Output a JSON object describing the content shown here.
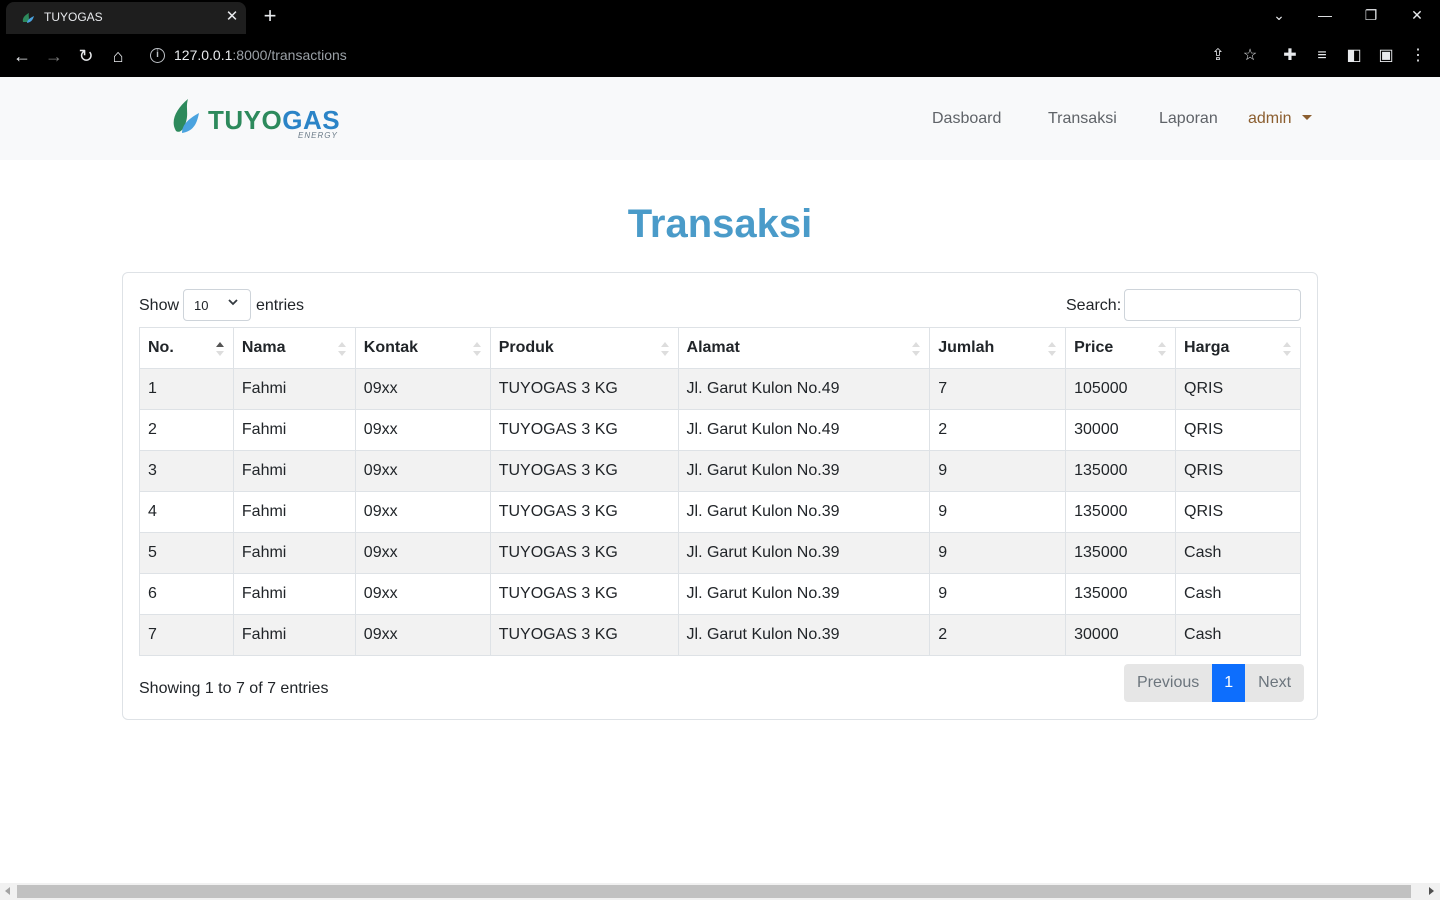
{
  "browser": {
    "tab_title": "TUYOGAS",
    "url_host": "127.0.0.1",
    "url_path": ":8000/transactions"
  },
  "navbar": {
    "brand_name_1": "TUYO",
    "brand_name_2": "GAS",
    "brand_sub": "ENERGY",
    "links": [
      "Dasboard",
      "Transaksi",
      "Laporan"
    ],
    "user": "admin"
  },
  "page": {
    "title": "Transaksi"
  },
  "table_controls": {
    "show_label": "Show",
    "entries_value": "10",
    "entries_label": "entries",
    "search_label": "Search:",
    "search_value": ""
  },
  "table": {
    "columns": [
      "No.",
      "Nama",
      "Kontak",
      "Produk",
      "Alamat",
      "Jumlah",
      "Price",
      "Harga"
    ],
    "sorted_column": "No.",
    "sort_direction": "asc",
    "rows": [
      [
        "1",
        "Fahmi",
        "09xx",
        "TUYOGAS 3 KG",
        "Jl. Garut Kulon No.49",
        "7",
        "105000",
        "QRIS"
      ],
      [
        "2",
        "Fahmi",
        "09xx",
        "TUYOGAS 3 KG",
        "Jl. Garut Kulon No.49",
        "2",
        "30000",
        "QRIS"
      ],
      [
        "3",
        "Fahmi",
        "09xx",
        "TUYOGAS 3 KG",
        "Jl. Garut Kulon No.39",
        "9",
        "135000",
        "QRIS"
      ],
      [
        "4",
        "Fahmi",
        "09xx",
        "TUYOGAS 3 KG",
        "Jl. Garut Kulon No.39",
        "9",
        "135000",
        "QRIS"
      ],
      [
        "5",
        "Fahmi",
        "09xx",
        "TUYOGAS 3 KG",
        "Jl. Garut Kulon No.39",
        "9",
        "135000",
        "Cash"
      ],
      [
        "6",
        "Fahmi",
        "09xx",
        "TUYOGAS 3 KG",
        "Jl. Garut Kulon No.39",
        "9",
        "135000",
        "Cash"
      ],
      [
        "7",
        "Fahmi",
        "09xx",
        "TUYOGAS 3 KG",
        "Jl. Garut Kulon No.39",
        "2",
        "30000",
        "Cash"
      ]
    ]
  },
  "footer": {
    "info": "Showing 1 to 7 of 7 entries",
    "prev_label": "Previous",
    "current_page": "1",
    "next_label": "Next"
  },
  "colors": {
    "title": "#4a9bc9",
    "active_page": "#0d6efd",
    "brand_green": "#2d8a5c",
    "brand_blue": "#2b84c7"
  }
}
